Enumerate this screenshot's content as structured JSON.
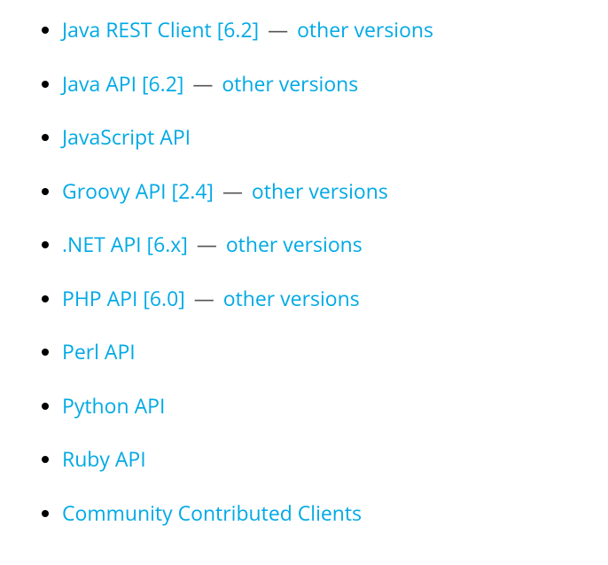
{
  "items": [
    {
      "label": "Java REST Client [6.2]",
      "has_other": true,
      "other_label": "other versions"
    },
    {
      "label": "Java API [6.2]",
      "has_other": true,
      "other_label": "other versions"
    },
    {
      "label": "JavaScript API",
      "has_other": false
    },
    {
      "label": "Groovy API [2.4]",
      "has_other": true,
      "other_label": "other versions"
    },
    {
      "label": ".NET API [6.x]",
      "has_other": true,
      "other_label": "other versions"
    },
    {
      "label": "PHP API [6.0]",
      "has_other": true,
      "other_label": "other versions"
    },
    {
      "label": "Perl API",
      "has_other": false
    },
    {
      "label": "Python API",
      "has_other": false
    },
    {
      "label": "Ruby API",
      "has_other": false
    },
    {
      "label": "Community Contributed Clients",
      "has_other": false
    }
  ],
  "separator": "—"
}
